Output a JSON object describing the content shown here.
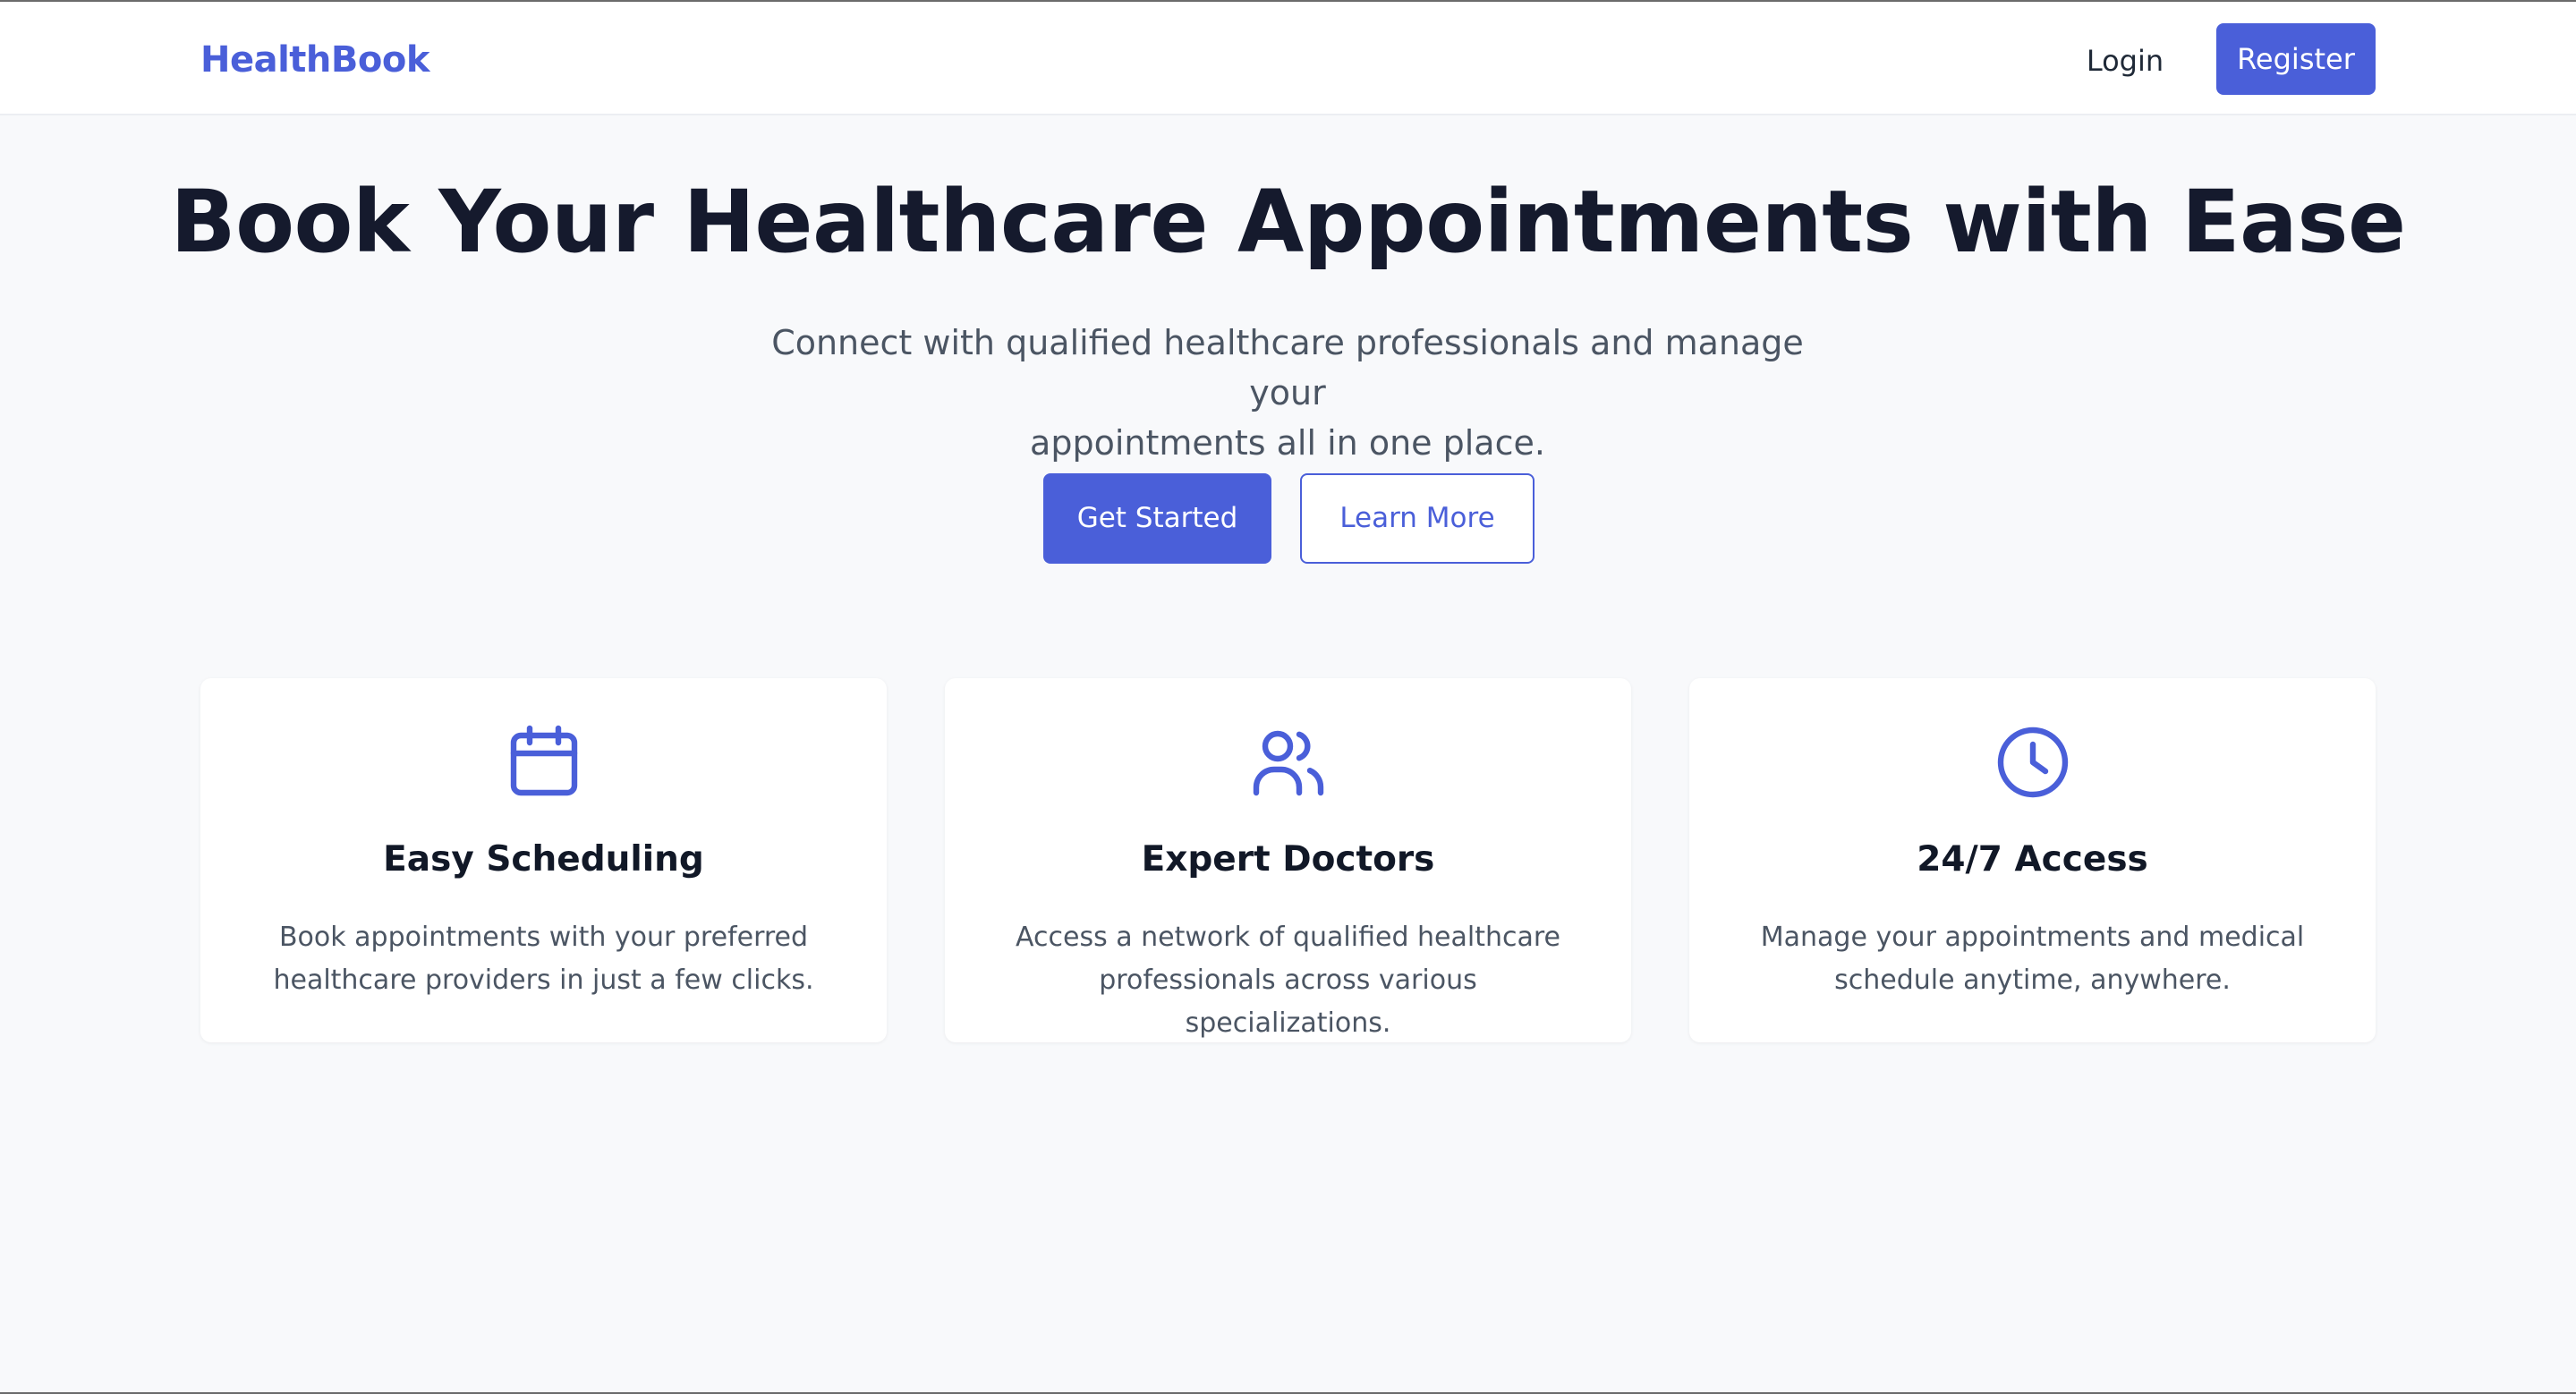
{
  "nav": {
    "brand": "HealthBook",
    "login": "Login",
    "register": "Register"
  },
  "hero": {
    "title": "Book Your Healthcare Appointments with Ease",
    "subtitle_line1": "Connect with qualified healthcare professionals and manage your",
    "subtitle_line2": "appointments all in one place.",
    "primary_button": "Get Started",
    "secondary_button": "Learn More"
  },
  "features": [
    {
      "icon": "calendar-icon",
      "title": "Easy Scheduling",
      "desc_line1": "Book appointments with your preferred",
      "desc_line2": "healthcare providers in just a few clicks."
    },
    {
      "icon": "users-icon",
      "title": "Expert Doctors",
      "desc_line1": "Access a network of qualified healthcare",
      "desc_line2": "professionals across various specializations."
    },
    {
      "icon": "clock-icon",
      "title": "24/7 Access",
      "desc_line1": "Manage your appointments and medical",
      "desc_line2": "schedule anytime, anywhere."
    }
  ],
  "colors": {
    "accent": "#4a5fd9",
    "background": "#f8f9fb",
    "heading": "#151a2d",
    "body_text": "#4b5563"
  }
}
